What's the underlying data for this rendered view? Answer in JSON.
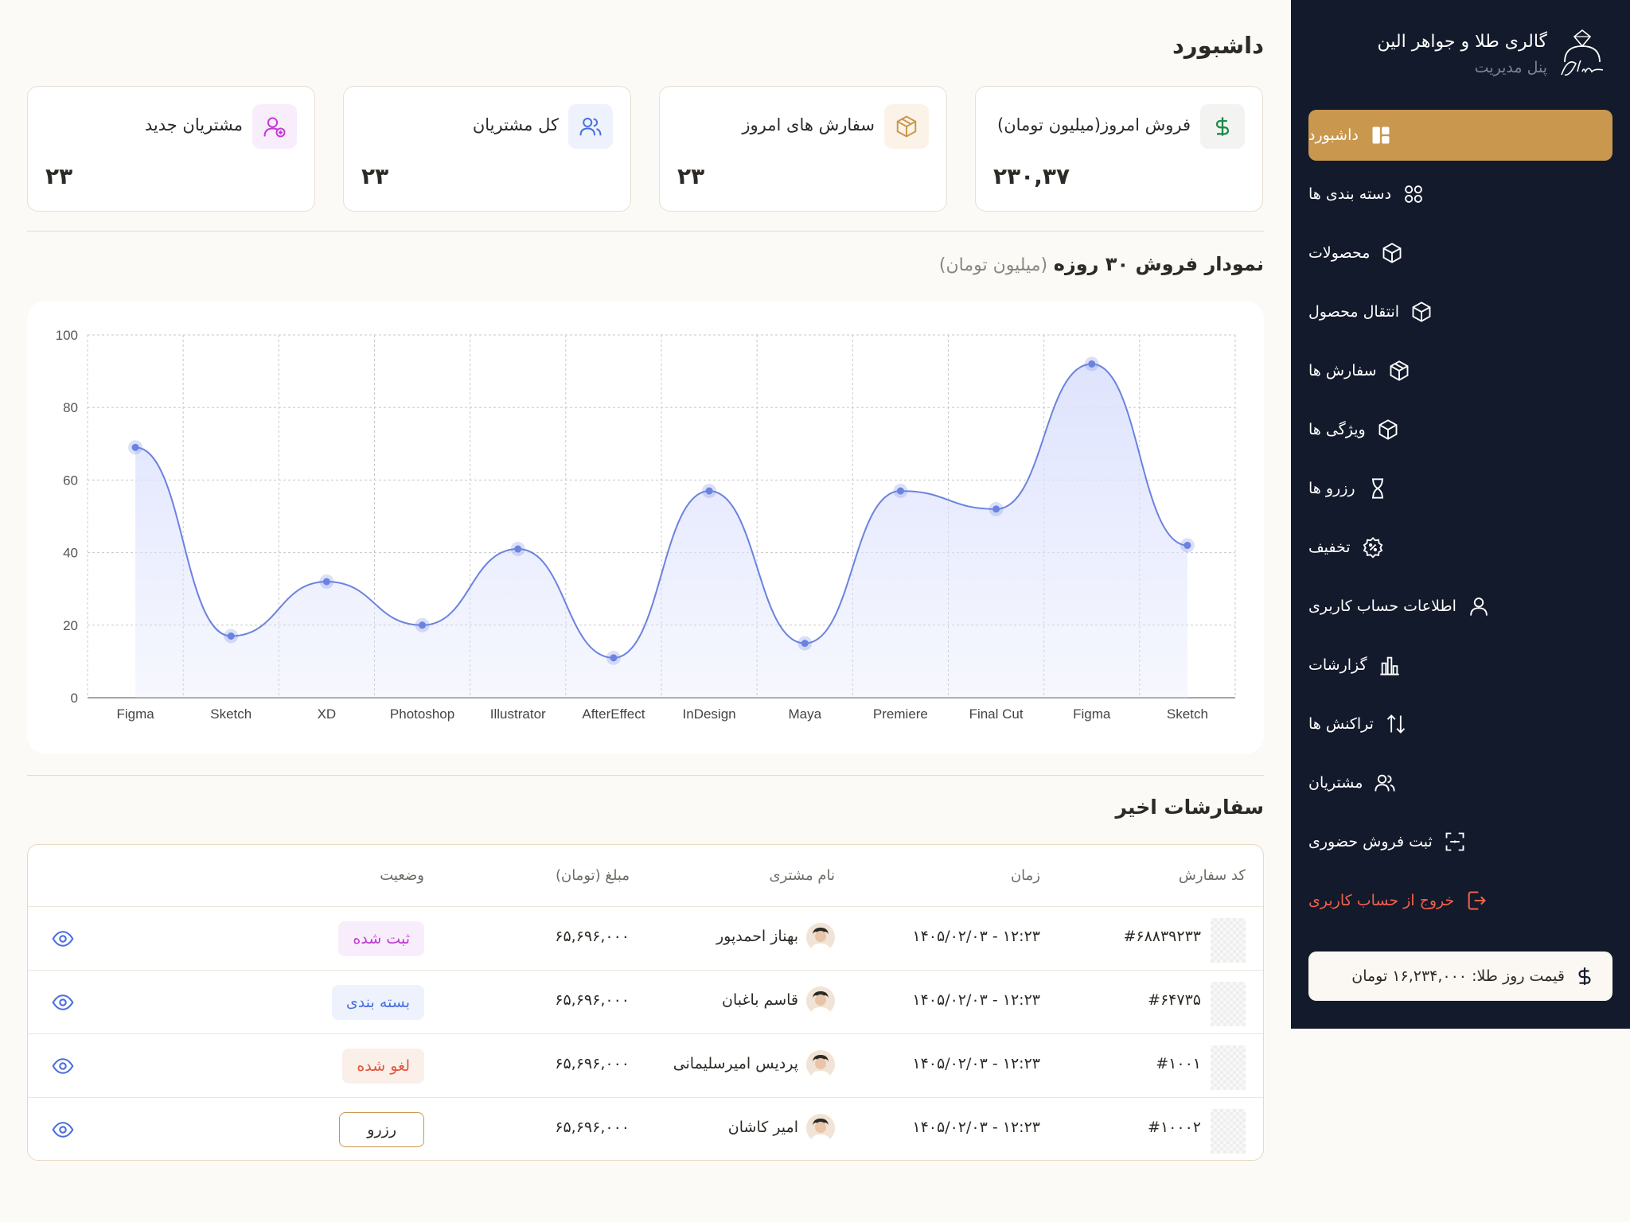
{
  "brand": {
    "title": "گالری طلا و جواهر الین",
    "subtitle": "پنل مدیریت"
  },
  "nav": [
    {
      "label": "داشبورد",
      "icon": "dashboard-icon",
      "active": true
    },
    {
      "label": "دسته بندی ها",
      "icon": "grid-icon"
    },
    {
      "label": "محصولات",
      "icon": "box-icon"
    },
    {
      "label": "انتقال محصول",
      "icon": "box-icon"
    },
    {
      "label": "سفارش ها",
      "icon": "package-icon"
    },
    {
      "label": "ویژگی ها",
      "icon": "box-icon"
    },
    {
      "label": "رزرو ها",
      "icon": "hourglass-icon"
    },
    {
      "label": "تخفیف",
      "icon": "discount-icon"
    },
    {
      "label": "اطلاعات حساب کاربری",
      "icon": "user-icon"
    },
    {
      "label": "گزارشات",
      "icon": "report-icon"
    },
    {
      "label": "تراکنش ها",
      "icon": "transactions-icon"
    },
    {
      "label": "مشتریان",
      "icon": "users-icon"
    },
    {
      "label": "ثبت فروش حضوری",
      "icon": "scan-icon"
    },
    {
      "label": "خروج از حساب کاربری",
      "icon": "logout-icon",
      "logout": true
    }
  ],
  "gold_price": "قیمت روز طلا: ۱۶,۲۳۴,۰۰۰ تومان",
  "page_title": "داشبورد",
  "cards": [
    {
      "title": "فروش امروز(میلیون تومان)",
      "value": "۲۳۰,۳۷",
      "icon": "dollar-icon",
      "color": "#1f8a4c",
      "bg": "#f3f4f1"
    },
    {
      "title": "سفارش  های امروز",
      "value": "۲۳",
      "icon": "package-icon",
      "color": "#c9974e",
      "bg": "#fbf3e8"
    },
    {
      "title": "کل مشتریان",
      "value": "۲۳",
      "icon": "users-icon",
      "color": "#4a6ee0",
      "bg": "#eef2fc"
    },
    {
      "title": "مشتریان جدید",
      "value": "۲۳",
      "icon": "user-add-icon",
      "color": "#c23ad6",
      "bg": "#f8eefb"
    }
  ],
  "chart_title": {
    "main": "نمودار فروش ۳۰ روزه",
    "sub": "(میلیون تومان)"
  },
  "chart_data": {
    "type": "area",
    "categories": [
      "Figma",
      "Sketch",
      "XD",
      "Photoshop",
      "Illustrator",
      "AfterEffect",
      "InDesign",
      "Maya",
      "Premiere",
      "Final Cut",
      "Figma",
      "Sketch"
    ],
    "values": [
      69,
      17,
      32,
      20,
      41,
      11,
      57,
      15,
      57,
      52,
      92,
      42
    ],
    "ylim": [
      0,
      100
    ],
    "yticks": [
      0,
      20,
      40,
      60,
      80,
      100
    ],
    "grid": true,
    "line_color": "#6b82e0",
    "fill_color": "#dde2fd"
  },
  "orders_title": "سفارشات اخیر",
  "table": {
    "headers": [
      "کد سفارش",
      "زمان",
      "نام مشتری",
      "مبلغ (تومان)",
      "وضعیت"
    ],
    "rows": [
      {
        "code": "#۶۸۸۳۹۲۳۳",
        "time": "۱۲:۲۳ - ۱۴۰۵/۰۲/۰۳",
        "customer": "بهناز احمدپور",
        "amount": "۶۵,۶۹۶,۰۰۰",
        "status": "ثبت شده",
        "status_color": "#c23ad6",
        "status_bg": "#f8eefb",
        "status_border": "transparent"
      },
      {
        "code": "#۶۴۷۳۵",
        "time": "۱۲:۲۳ - ۱۴۰۵/۰۲/۰۳",
        "customer": "قاسم باغبان",
        "amount": "۶۵,۶۹۶,۰۰۰",
        "status": "بسته بندی",
        "status_color": "#4a6ee0",
        "status_bg": "#eef2fc",
        "status_border": "transparent"
      },
      {
        "code": "#۱۰۰۱",
        "time": "۱۲:۲۳ - ۱۴۰۵/۰۲/۰۳",
        "customer": "پردیس امیرسلیمانی",
        "amount": "۶۵,۶۹۶,۰۰۰",
        "status": "لغو شده",
        "status_color": "#e2553b",
        "status_bg": "#fbefe9",
        "status_border": "transparent"
      },
      {
        "code": "#۱۰۰۰۲",
        "time": "۱۲:۲۳ - ۱۴۰۵/۰۲/۰۳",
        "customer": "امیر کاشان",
        "amount": "۶۵,۶۹۶,۰۰۰",
        "status": "رزرو",
        "status_color": "#2d2a26",
        "status_bg": "#ffffff",
        "status_border": "#c9974e"
      }
    ]
  }
}
